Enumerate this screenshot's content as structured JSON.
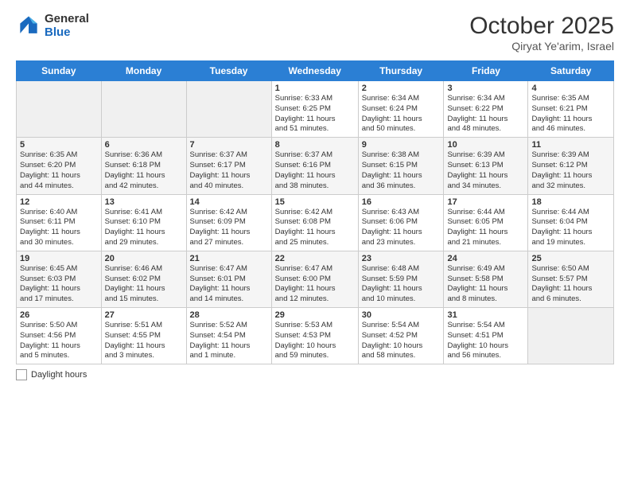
{
  "header": {
    "logo_general": "General",
    "logo_blue": "Blue",
    "month": "October 2025",
    "location": "Qiryat Ye'arim, Israel"
  },
  "weekdays": [
    "Sunday",
    "Monday",
    "Tuesday",
    "Wednesday",
    "Thursday",
    "Friday",
    "Saturday"
  ],
  "weeks": [
    [
      {
        "day": "",
        "info": ""
      },
      {
        "day": "",
        "info": ""
      },
      {
        "day": "",
        "info": ""
      },
      {
        "day": "1",
        "info": "Sunrise: 6:33 AM\nSunset: 6:25 PM\nDaylight: 11 hours\nand 51 minutes."
      },
      {
        "day": "2",
        "info": "Sunrise: 6:34 AM\nSunset: 6:24 PM\nDaylight: 11 hours\nand 50 minutes."
      },
      {
        "day": "3",
        "info": "Sunrise: 6:34 AM\nSunset: 6:22 PM\nDaylight: 11 hours\nand 48 minutes."
      },
      {
        "day": "4",
        "info": "Sunrise: 6:35 AM\nSunset: 6:21 PM\nDaylight: 11 hours\nand 46 minutes."
      }
    ],
    [
      {
        "day": "5",
        "info": "Sunrise: 6:35 AM\nSunset: 6:20 PM\nDaylight: 11 hours\nand 44 minutes."
      },
      {
        "day": "6",
        "info": "Sunrise: 6:36 AM\nSunset: 6:18 PM\nDaylight: 11 hours\nand 42 minutes."
      },
      {
        "day": "7",
        "info": "Sunrise: 6:37 AM\nSunset: 6:17 PM\nDaylight: 11 hours\nand 40 minutes."
      },
      {
        "day": "8",
        "info": "Sunrise: 6:37 AM\nSunset: 6:16 PM\nDaylight: 11 hours\nand 38 minutes."
      },
      {
        "day": "9",
        "info": "Sunrise: 6:38 AM\nSunset: 6:15 PM\nDaylight: 11 hours\nand 36 minutes."
      },
      {
        "day": "10",
        "info": "Sunrise: 6:39 AM\nSunset: 6:13 PM\nDaylight: 11 hours\nand 34 minutes."
      },
      {
        "day": "11",
        "info": "Sunrise: 6:39 AM\nSunset: 6:12 PM\nDaylight: 11 hours\nand 32 minutes."
      }
    ],
    [
      {
        "day": "12",
        "info": "Sunrise: 6:40 AM\nSunset: 6:11 PM\nDaylight: 11 hours\nand 30 minutes."
      },
      {
        "day": "13",
        "info": "Sunrise: 6:41 AM\nSunset: 6:10 PM\nDaylight: 11 hours\nand 29 minutes."
      },
      {
        "day": "14",
        "info": "Sunrise: 6:42 AM\nSunset: 6:09 PM\nDaylight: 11 hours\nand 27 minutes."
      },
      {
        "day": "15",
        "info": "Sunrise: 6:42 AM\nSunset: 6:08 PM\nDaylight: 11 hours\nand 25 minutes."
      },
      {
        "day": "16",
        "info": "Sunrise: 6:43 AM\nSunset: 6:06 PM\nDaylight: 11 hours\nand 23 minutes."
      },
      {
        "day": "17",
        "info": "Sunrise: 6:44 AM\nSunset: 6:05 PM\nDaylight: 11 hours\nand 21 minutes."
      },
      {
        "day": "18",
        "info": "Sunrise: 6:44 AM\nSunset: 6:04 PM\nDaylight: 11 hours\nand 19 minutes."
      }
    ],
    [
      {
        "day": "19",
        "info": "Sunrise: 6:45 AM\nSunset: 6:03 PM\nDaylight: 11 hours\nand 17 minutes."
      },
      {
        "day": "20",
        "info": "Sunrise: 6:46 AM\nSunset: 6:02 PM\nDaylight: 11 hours\nand 15 minutes."
      },
      {
        "day": "21",
        "info": "Sunrise: 6:47 AM\nSunset: 6:01 PM\nDaylight: 11 hours\nand 14 minutes."
      },
      {
        "day": "22",
        "info": "Sunrise: 6:47 AM\nSunset: 6:00 PM\nDaylight: 11 hours\nand 12 minutes."
      },
      {
        "day": "23",
        "info": "Sunrise: 6:48 AM\nSunset: 5:59 PM\nDaylight: 11 hours\nand 10 minutes."
      },
      {
        "day": "24",
        "info": "Sunrise: 6:49 AM\nSunset: 5:58 PM\nDaylight: 11 hours\nand 8 minutes."
      },
      {
        "day": "25",
        "info": "Sunrise: 6:50 AM\nSunset: 5:57 PM\nDaylight: 11 hours\nand 6 minutes."
      }
    ],
    [
      {
        "day": "26",
        "info": "Sunrise: 5:50 AM\nSunset: 4:56 PM\nDaylight: 11 hours\nand 5 minutes."
      },
      {
        "day": "27",
        "info": "Sunrise: 5:51 AM\nSunset: 4:55 PM\nDaylight: 11 hours\nand 3 minutes."
      },
      {
        "day": "28",
        "info": "Sunrise: 5:52 AM\nSunset: 4:54 PM\nDaylight: 11 hours\nand 1 minute."
      },
      {
        "day": "29",
        "info": "Sunrise: 5:53 AM\nSunset: 4:53 PM\nDaylight: 10 hours\nand 59 minutes."
      },
      {
        "day": "30",
        "info": "Sunrise: 5:54 AM\nSunset: 4:52 PM\nDaylight: 10 hours\nand 58 minutes."
      },
      {
        "day": "31",
        "info": "Sunrise: 5:54 AM\nSunset: 4:51 PM\nDaylight: 10 hours\nand 56 minutes."
      },
      {
        "day": "",
        "info": ""
      }
    ]
  ],
  "footer": {
    "label": "Daylight hours"
  }
}
